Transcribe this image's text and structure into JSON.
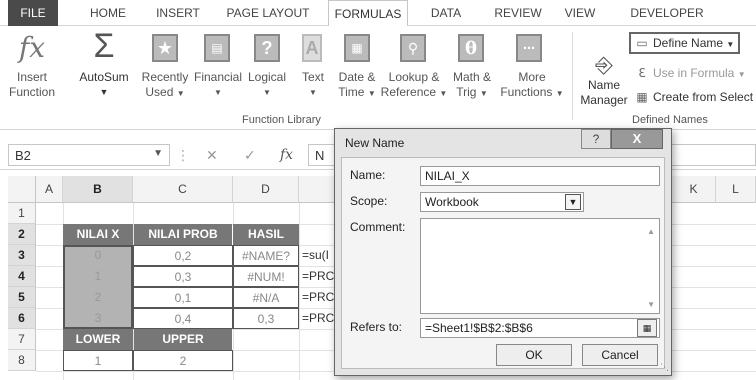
{
  "ribbon_tabs": [
    "FILE",
    "HOME",
    "INSERT",
    "PAGE LAYOUT",
    "FORMULAS",
    "DATA",
    "REVIEW",
    "VIEW",
    "DEVELOPER"
  ],
  "ribbon": {
    "insert_function": [
      "Insert",
      "Function"
    ],
    "autosum": "AutoSum",
    "recently_used": [
      "Recently",
      "Used"
    ],
    "financial": "Financial",
    "logical": "Logical",
    "text": "Text",
    "date_time": [
      "Date &",
      "Time"
    ],
    "lookup_reference": [
      "Lookup &",
      "Reference"
    ],
    "math_trig": [
      "Math &",
      "Trig"
    ],
    "more_functions": [
      "More",
      "Functions"
    ],
    "group_function_library": "Function Library",
    "name_manager": [
      "Name",
      "Manager"
    ],
    "define_name": "Define Name",
    "use_in_formula": "Use in Formula",
    "create_from_selection": "Create from Select",
    "group_defined_names": "Defined Names"
  },
  "formula_bar": {
    "name_box": "B2",
    "fx": "fx",
    "formula": "N"
  },
  "columns": [
    "A",
    "B",
    "C",
    "D",
    "",
    "K",
    "L"
  ],
  "rows": [
    "1",
    "2",
    "3",
    "4",
    "5",
    "6",
    "7",
    "8"
  ],
  "table": {
    "headers": [
      "NILAI X",
      "NILAI PROB",
      "HASIL"
    ],
    "rows": [
      [
        "0",
        "0,2",
        "#NAME?",
        "=su(I"
      ],
      [
        "1",
        "0,3",
        "#NUM!",
        "=PRC"
      ],
      [
        "2",
        "0,1",
        "#N/A",
        "=PRC"
      ],
      [
        "3",
        "0,4",
        "0,3",
        "=PRC"
      ]
    ],
    "lower_upper_headers": [
      "LOWER",
      "UPPER"
    ],
    "lower_upper_values": [
      "1",
      "2"
    ]
  },
  "dialog": {
    "title": "New Name",
    "help": "?",
    "close": "X",
    "name_label": "Name:",
    "name_value": "NILAI_X",
    "scope_label": "Scope:",
    "scope_value": "Workbook",
    "comment_label": "Comment:",
    "comment_value": "",
    "refers_label": "Refers to:",
    "refers_value": "=Sheet1!$B$2:$B$6",
    "ok": "OK",
    "cancel": "Cancel"
  },
  "colors": {
    "header_fill": "#777777",
    "selection_fill": "#b3b3b3",
    "file_tab": "#4a4a4a"
  }
}
